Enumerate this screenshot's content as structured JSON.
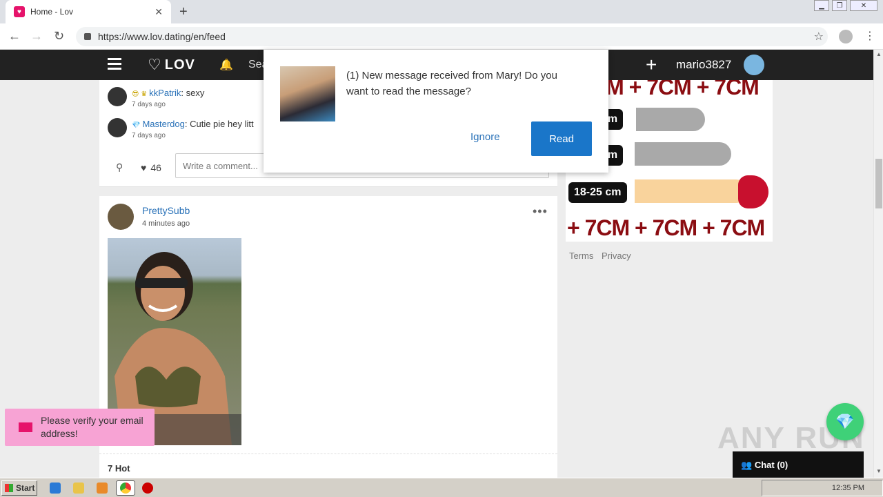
{
  "browser": {
    "tab_title": "Home - Lov",
    "tab_close": "✕",
    "new_tab": "+",
    "url": "https://www.lov.dating/en/feed",
    "back_icon": "arrow-left-icon",
    "forward_icon": "arrow-right-icon",
    "reload_icon": "reload-icon",
    "window_minimize": "▁",
    "window_restore": "❐",
    "window_close": "✕"
  },
  "header": {
    "logo": "LOV",
    "search_label": "Sea",
    "add": "+",
    "username": "mario3827"
  },
  "feed": {
    "comments": [
      {
        "user": "kkPatrik",
        "text": ": sexy",
        "time": "7 days ago"
      },
      {
        "user": "Masterdog",
        "text": ": Cutie pie hey litt",
        "time": "7 days ago"
      }
    ],
    "likes": "46",
    "comment_placeholder": "Write a comment...",
    "post": {
      "author": "PrettySubb",
      "time": "4 minutes ago",
      "more": "•••",
      "hot": "7 Hot"
    }
  },
  "ad": {
    "line_top": "CM + 7CM + 7CM",
    "pill1": "cm",
    "pill2": "cm",
    "pill3": "18-25 cm",
    "line_bottom": "+ 7CM + 7CM + 7CM"
  },
  "footer": {
    "terms": "Terms",
    "privacy": "Privacy"
  },
  "popup": {
    "message": "(1) New message received from Mary! Do you want to read the message?",
    "ignore": "Ignore",
    "read": "Read"
  },
  "toast": {
    "message": "Please verify your email address!"
  },
  "chat": {
    "label": "Chat (0)"
  },
  "watermark": "ANY RUN",
  "taskbar": {
    "start": "Start",
    "time": "12:35 PM"
  }
}
